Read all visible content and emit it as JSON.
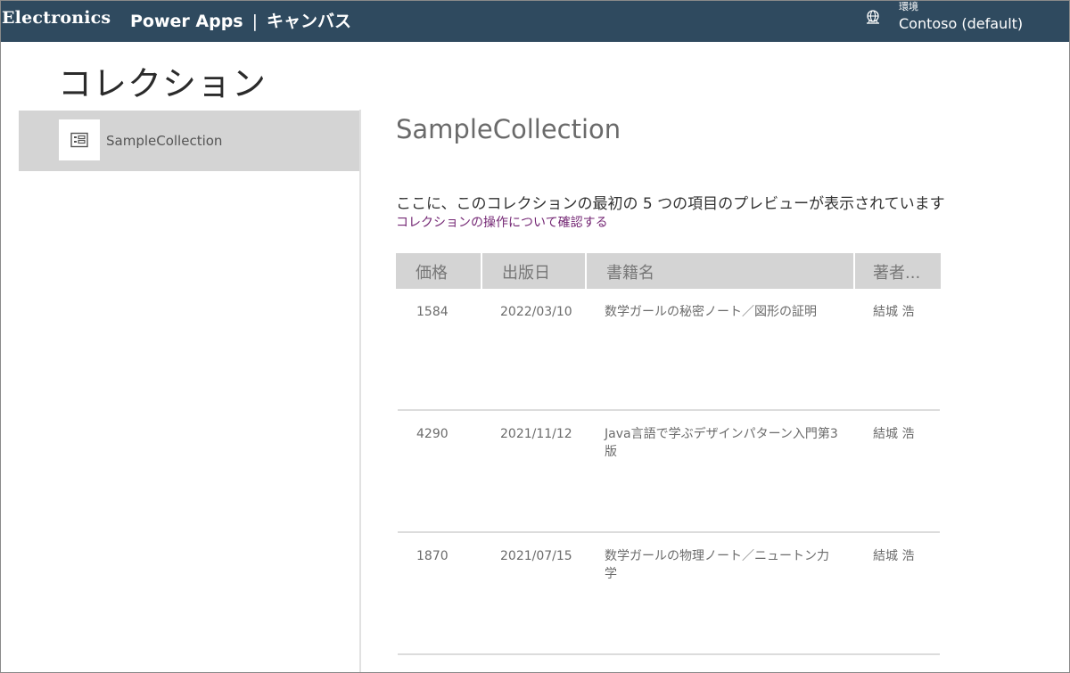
{
  "topbar": {
    "brand": "Electronics",
    "app_name": "Power Apps",
    "separator": "|",
    "section": "キャンバス",
    "environment_label": "環境",
    "environment_name": "Contoso (default)",
    "environment_icon": "globe-icon",
    "background_color": "#2f4a5f"
  },
  "page": {
    "title": "コレクション"
  },
  "sidebar": {
    "items": [
      {
        "label": "SampleCollection",
        "icon": "collection-icon",
        "selected": true
      }
    ]
  },
  "detail": {
    "title": "SampleCollection",
    "description": "ここに、このコレクションの最初の 5 つの項目のプレビューが表示されています",
    "link_text": "コレクションの操作について確認する",
    "link_color": "#742774"
  },
  "table": {
    "columns": [
      "価格",
      "出版日",
      "書籍名",
      "著者..."
    ],
    "rows": [
      {
        "price": "1584",
        "date": "2022/03/10",
        "title": "数学ガールの秘密ノート／図形の証明",
        "author": "結城 浩"
      },
      {
        "price": "4290",
        "date": "2021/11/12",
        "title": "Java言語で学ぶデザインパターン入門第3版",
        "author": "結城 浩"
      },
      {
        "price": "1870",
        "date": "2021/07/15",
        "title": "数学ガールの物理ノート／ニュートン力学",
        "author": "結城 浩"
      }
    ]
  }
}
